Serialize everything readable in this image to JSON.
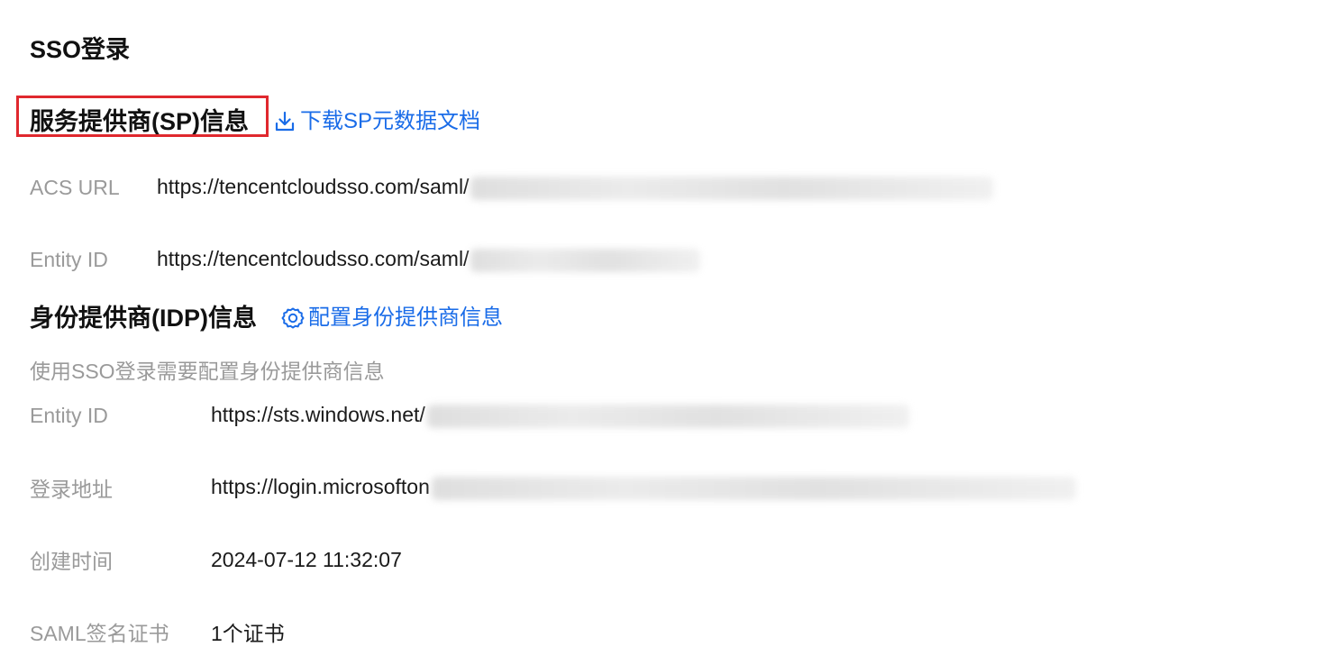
{
  "page": {
    "title": "SSO登录"
  },
  "sp_section": {
    "title": "服务提供商(SP)信息",
    "download_link": "下载SP元数据文档",
    "download_icon": "download-icon",
    "fields": {
      "acs_url_label": "ACS URL",
      "acs_url_value": "https://tencentcloudsso.com/saml/",
      "entity_id_label": "Entity ID",
      "entity_id_value": "https://tencentcloudsso.com/saml/"
    }
  },
  "idp_section": {
    "title": "身份提供商(IDP)信息",
    "configure_link": "配置身份提供商信息",
    "configure_icon": "gear-icon",
    "hint": "使用SSO登录需要配置身份提供商信息",
    "fields": {
      "entity_id_label": "Entity ID",
      "entity_id_value": "https://sts.windows.net/",
      "login_url_label": "登录地址",
      "login_url_value": "https://login.microsofton",
      "created_label": "创建时间",
      "created_value": "2024-07-12 11:32:07",
      "cert_label": "SAML签名证书",
      "cert_value": "1个证书"
    }
  },
  "colors": {
    "link": "#1a6ce8",
    "highlight": "#e0282e",
    "label": "#9a9a9a"
  }
}
